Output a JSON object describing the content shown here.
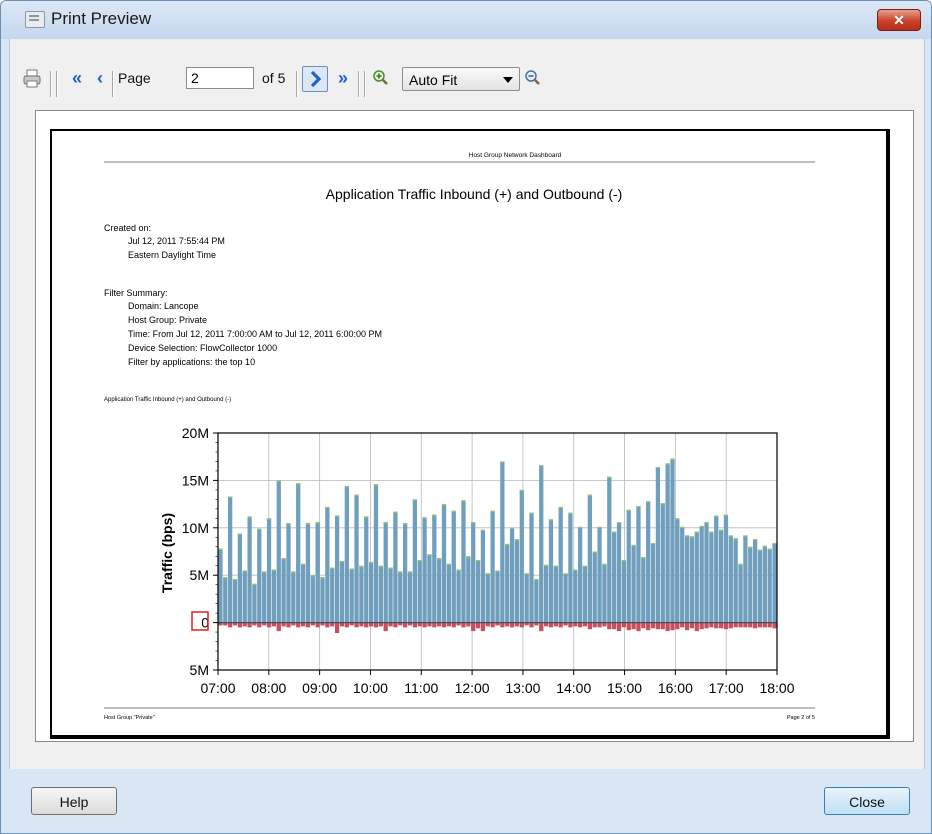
{
  "window": {
    "title": "Print Preview"
  },
  "toolbar": {
    "page_label": "Page",
    "page_value": "2",
    "of_label": "of 5",
    "zoom_select": "Auto Fit"
  },
  "report": {
    "header": "Host Group Network Dashboard",
    "title": "Application Traffic Inbound (+) and Outbound (-)",
    "created_label": "Created on:",
    "created_date": "Jul 12, 2011 7:55:44 PM",
    "created_tz": "Eastern Daylight Time",
    "filter_label": "Filter Summary:",
    "filters": [
      "Domain: Lancope",
      "Host Group: Private",
      "Time: From Jul 12, 2011 7:00:00 AM to Jul 12, 2011 6:00:00 PM",
      "Device Selection: FlowCollector 1000",
      "Filter by applications: the top 10"
    ],
    "chart_caption": "Application Traffic Inbound (+) and Outbound (-)",
    "footer_left": "Host Group \"Private\"",
    "footer_right": "Page 2 of  5"
  },
  "chart_data": {
    "type": "bar",
    "ylabel": "Traffic (bps)",
    "ylim": [
      -5000000,
      20000000
    ],
    "yticks": [
      {
        "value": 20000000,
        "label": "20M"
      },
      {
        "value": 15000000,
        "label": "15M"
      },
      {
        "value": 10000000,
        "label": "10M"
      },
      {
        "value": 5000000,
        "label": "5M"
      },
      {
        "value": 0,
        "label": "0"
      },
      {
        "value": -5000000,
        "label": "5M"
      }
    ],
    "xticks": [
      "07:00",
      "08:00",
      "09:00",
      "10:00",
      "11:00",
      "12:00",
      "13:00",
      "14:00",
      "15:00",
      "16:00",
      "17:00",
      "18:00"
    ],
    "grid": true,
    "inbound_color": "#6f9fbd",
    "outbound_color": "#c8505e",
    "inbound": [
      7.8,
      4.8,
      13.3,
      4.6,
      9.4,
      5.5,
      11.2,
      4.1,
      9.9,
      5.4,
      11.0,
      5.6,
      15.0,
      6.8,
      10.5,
      5.4,
      14.7,
      6.2,
      10.5,
      5.0,
      10.6,
      4.8,
      12.2,
      5.8,
      11.3,
      6.5,
      14.4,
      5.7,
      13.5,
      6.0,
      11.2,
      6.4,
      14.6,
      6.0,
      10.6,
      5.8,
      11.7,
      5.4,
      10.5,
      5.4,
      13.0,
      6.6,
      11.1,
      7.2,
      11.4,
      6.8,
      12.5,
      6.2,
      11.8,
      5.6,
      12.9,
      7.0,
      10.6,
      6.6,
      9.8,
      5.2,
      11.8,
      5.5,
      17.0,
      8.3,
      10.0,
      8.8,
      14.0,
      5.2,
      11.6,
      4.6,
      16.6,
      6.1,
      10.9,
      6.0,
      12.2,
      5.2,
      11.6,
      5.6,
      10.1,
      6.0,
      13.5,
      7.5,
      10.1,
      6.2,
      15.4,
      9.6,
      10.6,
      6.6,
      11.9,
      8.2,
      12.3,
      6.9,
      12.8,
      8.4,
      16.4,
      12.6,
      16.8,
      17.3,
      11.0,
      10.1,
      9.2,
      9.1,
      9.6,
      10.2,
      10.6,
      9.6,
      11.3,
      9.8,
      11.4,
      9.2,
      8.9,
      6.2,
      9.2,
      8.0,
      8.8,
      7.7,
      8.1,
      7.8,
      8.4
    ],
    "outbound": [
      0.3,
      0.3,
      0.5,
      0.3,
      0.5,
      0.4,
      0.5,
      0.3,
      0.5,
      0.3,
      0.5,
      0.4,
      0.9,
      0.4,
      0.5,
      0.3,
      0.5,
      0.4,
      0.5,
      0.3,
      0.5,
      0.3,
      0.5,
      0.4,
      1.1,
      0.4,
      0.5,
      0.3,
      0.5,
      0.4,
      0.5,
      0.4,
      0.5,
      0.4,
      0.9,
      0.4,
      0.5,
      0.3,
      0.5,
      0.3,
      0.5,
      0.4,
      0.5,
      0.4,
      0.5,
      0.4,
      0.5,
      0.4,
      0.5,
      0.3,
      0.5,
      0.4,
      0.9,
      0.6,
      0.9,
      0.4,
      0.5,
      0.3,
      0.5,
      0.4,
      0.5,
      0.4,
      0.5,
      0.3,
      0.5,
      0.3,
      0.9,
      0.4,
      0.5,
      0.4,
      0.5,
      0.3,
      0.5,
      0.4,
      0.5,
      0.4,
      0.7,
      0.5,
      0.5,
      0.4,
      0.7,
      0.7,
      0.9,
      0.5,
      0.8,
      0.7,
      0.9,
      0.6,
      0.8,
      0.6,
      0.7,
      0.7,
      0.9,
      0.8,
      0.7,
      0.5,
      0.8,
      0.6,
      0.9,
      0.7,
      0.6,
      0.5,
      0.6,
      0.6,
      0.7,
      0.6,
      0.5,
      0.5,
      0.5,
      0.5,
      0.6,
      0.5,
      0.5,
      0.5,
      0.6
    ]
  }
}
